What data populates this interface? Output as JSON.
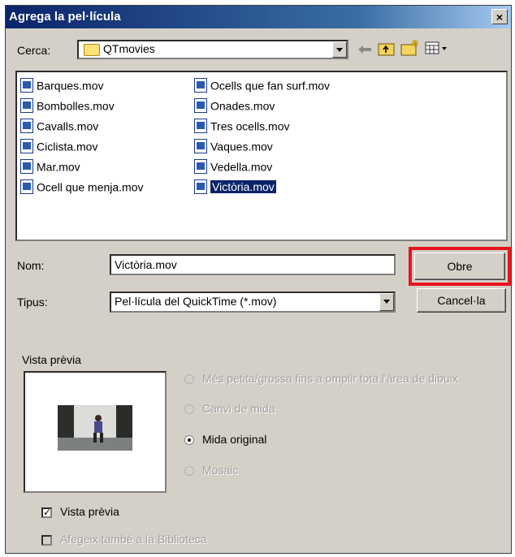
{
  "window": {
    "title": "Agrega la pel·lícula",
    "close_label": "×"
  },
  "location": {
    "label": "Cerca:",
    "folder": "QTmovies"
  },
  "files": [
    {
      "name": "Barques.mov",
      "selected": false
    },
    {
      "name": "Bombolles.mov",
      "selected": false
    },
    {
      "name": "Cavalls.mov",
      "selected": false
    },
    {
      "name": "Ciclista.mov",
      "selected": false
    },
    {
      "name": "Mar.mov",
      "selected": false
    },
    {
      "name": "Ocell que menja.mov",
      "selected": false
    },
    {
      "name": "Ocells que fan surf.mov",
      "selected": false
    },
    {
      "name": "Onades.mov",
      "selected": false
    },
    {
      "name": "Tres ocells.mov",
      "selected": false
    },
    {
      "name": "Vaques.mov",
      "selected": false
    },
    {
      "name": "Vedella.mov",
      "selected": false
    },
    {
      "name": "Victòria.mov",
      "selected": true
    }
  ],
  "filename": {
    "label": "Nom:",
    "value": "Victòria.mov"
  },
  "filetype": {
    "label": "Tipus:",
    "value": "Pel·lícula del QuickTime (*.mov)"
  },
  "buttons": {
    "open": "Obre",
    "cancel": "Cancel·la"
  },
  "highlight_color": "#e8141c",
  "preview": {
    "label": "Vista prèvia"
  },
  "options": {
    "fill": "Més petita/grossa fins a omplir tota l'àrea de dibuix",
    "resize": "Canvi de mida",
    "original": "Mida original",
    "tile": "Mosaic"
  },
  "checkboxes": {
    "preview": "Vista prèvia",
    "add_library": "Afegeix també a la Biblioteca"
  }
}
